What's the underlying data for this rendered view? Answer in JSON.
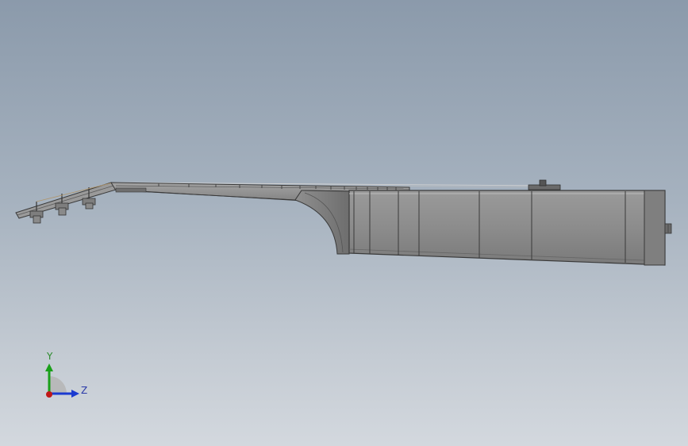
{
  "viewport": {
    "background_top": "#8b9aab",
    "background_bottom": "#d3d8de"
  },
  "model": {
    "name": "guitar-side-view",
    "body_color": "#8d8d8d",
    "edge_color": "#3a3a3a"
  },
  "triad": {
    "y_label": "Y",
    "z_label": "Z",
    "y_color": "#1aa01a",
    "z_color": "#1a3ad0",
    "x_color": "#c01818"
  }
}
